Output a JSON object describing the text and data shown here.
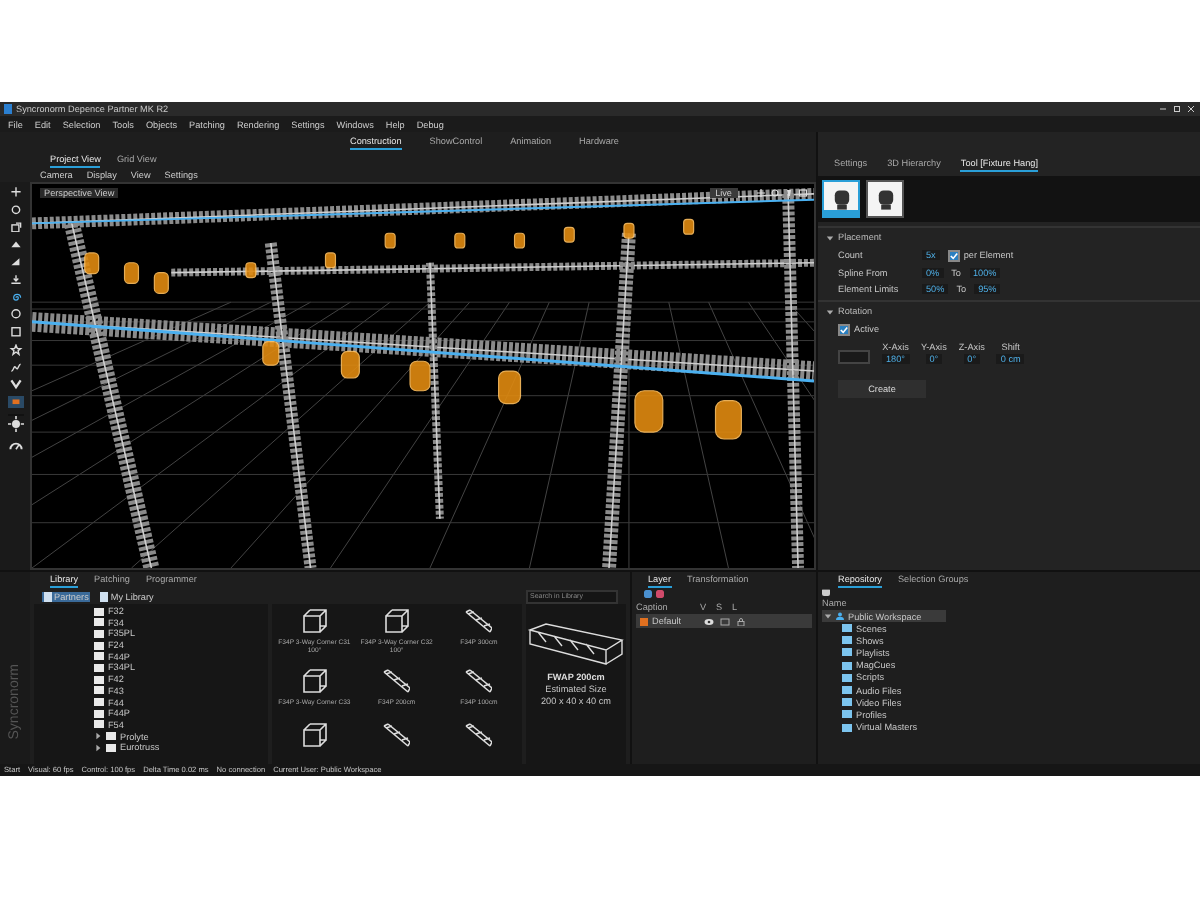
{
  "window": {
    "title": "Syncronorm Depence Partner MK R2"
  },
  "menu": [
    "File",
    "Edit",
    "Selection",
    "Tools",
    "Objects",
    "Patching",
    "Rendering",
    "Settings",
    "Windows",
    "Help",
    "Debug"
  ],
  "mode_tabs": [
    {
      "label": "Construction",
      "selected": true
    },
    {
      "label": "ShowControl",
      "selected": false
    },
    {
      "label": "Animation",
      "selected": false
    },
    {
      "label": "Hardware",
      "selected": false
    }
  ],
  "view_tabs": [
    {
      "label": "Project View",
      "selected": true
    },
    {
      "label": "Grid View",
      "selected": false
    }
  ],
  "view_menu": [
    "Camera",
    "Display",
    "View",
    "Settings"
  ],
  "viewport": {
    "label": "Perspective View",
    "live_button": "Live"
  },
  "right_tabs": [
    {
      "label": "Settings",
      "selected": false
    },
    {
      "label": "3D Hierarchy",
      "selected": false
    },
    {
      "label": "Tool [Fixture Hang]",
      "selected": true
    }
  ],
  "fixtures": [
    {
      "selected": true
    },
    {
      "selected": false
    }
  ],
  "placement": {
    "title": "Placement",
    "count_label": "Count",
    "count": "5x",
    "per_element": {
      "label": "per Element",
      "checked": true
    },
    "rows": [
      {
        "label": "Spline From",
        "from": "0%",
        "to_label": "To",
        "to": "100%"
      },
      {
        "label": "Element Limits",
        "from": "50%",
        "to_label": "To",
        "to": "95%"
      }
    ]
  },
  "rotation": {
    "title": "Rotation",
    "active": {
      "label": "Active",
      "checked": true
    },
    "axes": [
      {
        "label": "X-Axis",
        "value": "180°"
      },
      {
        "label": "Y-Axis",
        "value": "0°"
      },
      {
        "label": "Z-Axis",
        "value": "0°"
      },
      {
        "label": "Shift",
        "value": "0 cm"
      }
    ]
  },
  "create_button": "Create",
  "library": {
    "tabs": [
      {
        "label": "Library",
        "selected": true
      },
      {
        "label": "Patching",
        "selected": false
      },
      {
        "label": "Programmer",
        "selected": false
      }
    ],
    "sources": [
      {
        "label": "Partners",
        "selected": true
      },
      {
        "label": "My Library",
        "selected": false
      }
    ],
    "search": {
      "placeholder": "Search in Library"
    },
    "folders": [
      "F32",
      "F34",
      "F35PL",
      "F24",
      "F44P",
      "F34PL",
      "F42",
      "F43",
      "F44",
      "F44P",
      "F54"
    ],
    "vendors": [
      "Prolyte",
      "Eurotruss"
    ],
    "items": [
      {
        "label": "F34P 3-Way Corner C31 100°",
        "kind": "corner"
      },
      {
        "label": "F34P 3-Way Corner C32 100°",
        "kind": "corner"
      },
      {
        "label": "F34P 300cm",
        "kind": "straight"
      },
      {
        "label": "F34P 3-Way Corner C33",
        "kind": "corner"
      },
      {
        "label": "F34P 200cm",
        "kind": "straight"
      },
      {
        "label": "F34P 100cm",
        "kind": "straight"
      },
      {
        "kind": "corner"
      },
      {
        "kind": "straight"
      },
      {
        "kind": "straight"
      }
    ],
    "preview": {
      "name": "FWAP 200cm",
      "size_label": "Estimated Size",
      "size": "200 x 40 x 40 cm"
    }
  },
  "brand": "Syncronorm",
  "layers": {
    "tabs": [
      {
        "label": "Layer",
        "selected": true
      },
      {
        "label": "Transformation",
        "selected": false
      }
    ],
    "columns": [
      "Caption",
      "V",
      "S",
      "L"
    ],
    "rows": [
      {
        "name": "Default",
        "color": "#e07020",
        "selected": true
      }
    ]
  },
  "repository": {
    "tabs": [
      {
        "label": "Repository",
        "selected": true
      },
      {
        "label": "Selection Groups",
        "selected": false
      }
    ],
    "column": "Name",
    "tree": [
      {
        "label": "Public Workspace",
        "expanded": true,
        "selected": true,
        "children": [
          {
            "label": "Scenes"
          },
          {
            "label": "Shows"
          },
          {
            "label": "Playlists"
          },
          {
            "label": "MagCues"
          },
          {
            "label": "Scripts"
          },
          {
            "label": "Audio Files"
          },
          {
            "label": "Video Files"
          },
          {
            "label": "Profiles"
          },
          {
            "label": "Virtual Masters"
          }
        ]
      }
    ]
  },
  "status_bar": [
    "Start",
    "Visual: 60 fps",
    "Control: 100 fps",
    "Delta Time 0.02 ms",
    "No connection",
    "Current User: Public Workspace"
  ]
}
